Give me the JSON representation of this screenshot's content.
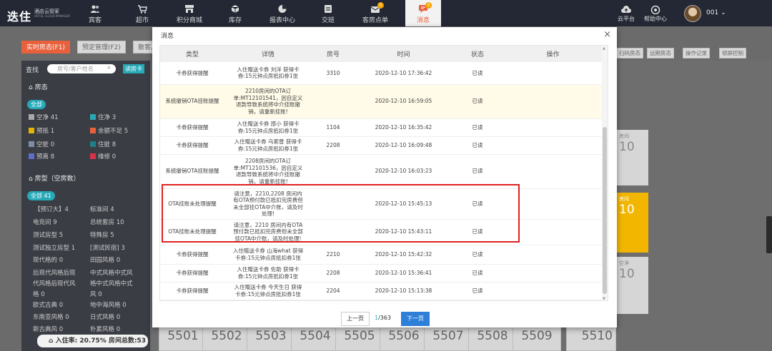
{
  "app": {
    "logo": "迭住",
    "logo_sub": "酒店云管家",
    "logo_sub2": "HOTEL CLOUD MANAGER"
  },
  "nav": [
    {
      "label": "宾客",
      "icon": "guests-icon"
    },
    {
      "label": "超市",
      "icon": "cart-icon"
    },
    {
      "label": "积分商城",
      "icon": "shop-icon"
    },
    {
      "label": "库存",
      "icon": "cube-icon"
    },
    {
      "label": "报表中心",
      "icon": "pie-chart-icon"
    },
    {
      "label": "交班",
      "icon": "handover-icon"
    },
    {
      "label": "客房点单",
      "icon": "order-icon",
      "badge": "0"
    },
    {
      "label": "消息",
      "icon": "message-icon",
      "badge": "0"
    }
  ],
  "right_nav": {
    "cloud": "云平台",
    "help": "帮助中心",
    "user": "001"
  },
  "tabs": [
    "实时房态(F1)",
    "预定管理(F2)",
    "散客入"
  ],
  "right_tabs": [
    "扫码房态",
    "远期房态",
    "操作记录",
    "锁屏控制"
  ],
  "sidebar": {
    "search_label": "查找",
    "search_placeholder": "房号/客户姓名",
    "read_card": "读房卡",
    "section_status": "房态",
    "all_label": "全部",
    "status_items": [
      {
        "label": "空净 41",
        "color": "#a8a8a8"
      },
      {
        "label": "住净 3",
        "color": "#27a9b8"
      },
      {
        "label": "预抵 1",
        "color": "#e6b400"
      },
      {
        "label": "余额不足 5",
        "color": "#e8603c"
      },
      {
        "label": "空脏 0",
        "color": "#7d8ea8"
      },
      {
        "label": "住脏 8",
        "color": "#1f7f8a"
      },
      {
        "label": "预离 8",
        "color": "#5b6fc8"
      },
      {
        "label": "维修 0",
        "color": "#d9304c"
      }
    ],
    "section_roomtype": "房型（空房数）",
    "all_count": "全部 41",
    "room_types": [
      [
        "【预订大】4",
        "标准间 4"
      ],
      [
        "电竞间 9",
        "总统套房 10"
      ],
      [
        "测试房型 5",
        "特殊房 5"
      ],
      [
        "测试独立房型 1",
        "[测试民宿] 3"
      ],
      [
        "现代格的 0",
        "田园风格 0"
      ],
      [
        "后现代风格后现",
        "中式风格中式风"
      ],
      [
        "代风格后现代风",
        "格中式风格中式"
      ],
      [
        "格 0",
        "风 0"
      ],
      [
        "欧式古典 0",
        "地中海风格 0"
      ],
      [
        "东南亚风格 0",
        "日式风格 0"
      ],
      [
        "新古典风 0",
        "朴素风格 0"
      ]
    ],
    "occupancy": "入住率: 20.75% 房间总数:53"
  },
  "rooms_bottom": [
    "5501",
    "5502",
    "5503",
    "5504",
    "5505",
    "5506",
    "5507",
    "5508",
    "5509",
    "5510"
  ],
  "rooms_side": [
    {
      "label": "房间",
      "number": "10"
    },
    {
      "label": "房间",
      "number": "10"
    },
    {
      "label": "空净",
      "number": "10"
    }
  ],
  "modal": {
    "title": "消息",
    "close": "×",
    "columns": [
      "类型",
      "详情",
      "房号",
      "时间",
      "状态",
      "操作"
    ],
    "rows": [
      {
        "type": "卡券获得提醒",
        "detail": "入住赠送卡券 刘洋 获得卡券:15元钟点房抵扣券1张",
        "room": "3310",
        "time": "2020-12-10 17:36:42",
        "status": "已读"
      },
      {
        "type": "系统撤销OTA挂账提醒",
        "detail": "2210房间的OTA订单:MT12101541，因自定义退款导致系统将中介挂账撤销，请重新挂账!",
        "room": "",
        "time": "2020-12-10 16:59:05",
        "status": "已读"
      },
      {
        "type": "卡券获得提醒",
        "detail": "入住赠送卡券 邵小 获得卡券:15元钟点房抵扣券1张",
        "room": "1104",
        "time": "2020-12-10 16:35:42",
        "status": "已读"
      },
      {
        "type": "卡券获得提醒",
        "detail": "入住赠送卡券 乌索普 获得卡券:15元钟点房抵扣券1张",
        "room": "2208",
        "time": "2020-12-10 16:09:48",
        "status": "已读"
      },
      {
        "type": "系统撤销OTA挂账提醒",
        "detail": "2208房间的OTA订单:MT12101536，因自定义退款导致系统将中介挂账撤销，请重新挂账!",
        "room": "",
        "time": "2020-12-10 16:03:23",
        "status": "已读"
      },
      {
        "type": "OTA挂账未处理提醒",
        "detail": "请注意，2210,2208 房间内有OTA预付款已抵扣完房费但未全部挂OTA中介账，请及时处理!",
        "room": "",
        "time": "2020-12-10 15:45:13",
        "status": "已读"
      },
      {
        "type": "OTA挂账未处理提醒",
        "detail": "请注意，2210 房间内有OTA预付款已抵扣完房费但未全部挂OTA中介账，请及时处理!",
        "room": "",
        "time": "2020-12-10 15:43:11",
        "status": "已读"
      },
      {
        "type": "卡券获得提醒",
        "detail": "入住赠送卡券 山海what 获得卡券:15元钟点房抵扣券1张",
        "room": "2210",
        "time": "2020-12-10 15:42:32",
        "status": "已读"
      },
      {
        "type": "卡券获得提醒",
        "detail": "入住赠送卡券 佐助 获得卡券:15元钟点房抵扣券1张",
        "room": "2208",
        "time": "2020-12-10 15:36:41",
        "status": "已读"
      },
      {
        "type": "卡券获得提醒",
        "detail": "入住赠送卡券 今天生日 获得卡券:15元钟点房抵扣券1张",
        "room": "2204",
        "time": "2020-12-10 15:13:38",
        "status": "已读"
      }
    ],
    "pager": {
      "prev": "上一页",
      "current": "1",
      "total": "/363",
      "next": "下一页"
    }
  }
}
